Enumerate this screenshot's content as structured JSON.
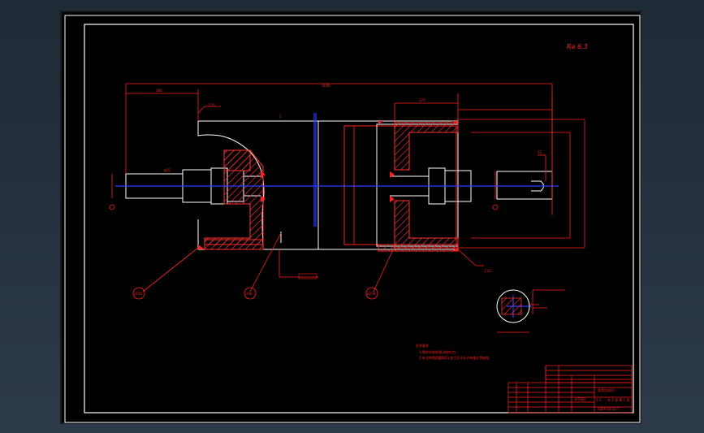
{
  "drawing": {
    "scale_note": "Ra 6.3",
    "leader_tags": {
      "left": "2210",
      "middle": "206",
      "right": "2208"
    },
    "notes_title": "技术要求",
    "notes_lines": [
      "1.铸件时效处理,消除应力.",
      "2.未注明铸造圆角R3,加工后不允许有缩孔等缺陷."
    ],
    "title_block": {
      "part_name": "滚筒总成(1)",
      "drawing_no": "GDJX-03-03-7",
      "material": "HT200",
      "scale": "1:1",
      "sheet": "共 1 张 第 1 张"
    }
  },
  "colors": {
    "frame": "#ffffff",
    "dim": "#ff2020",
    "axis": "#2a3cff",
    "hatch": "#ff3030",
    "outline": "#ffffff"
  }
}
